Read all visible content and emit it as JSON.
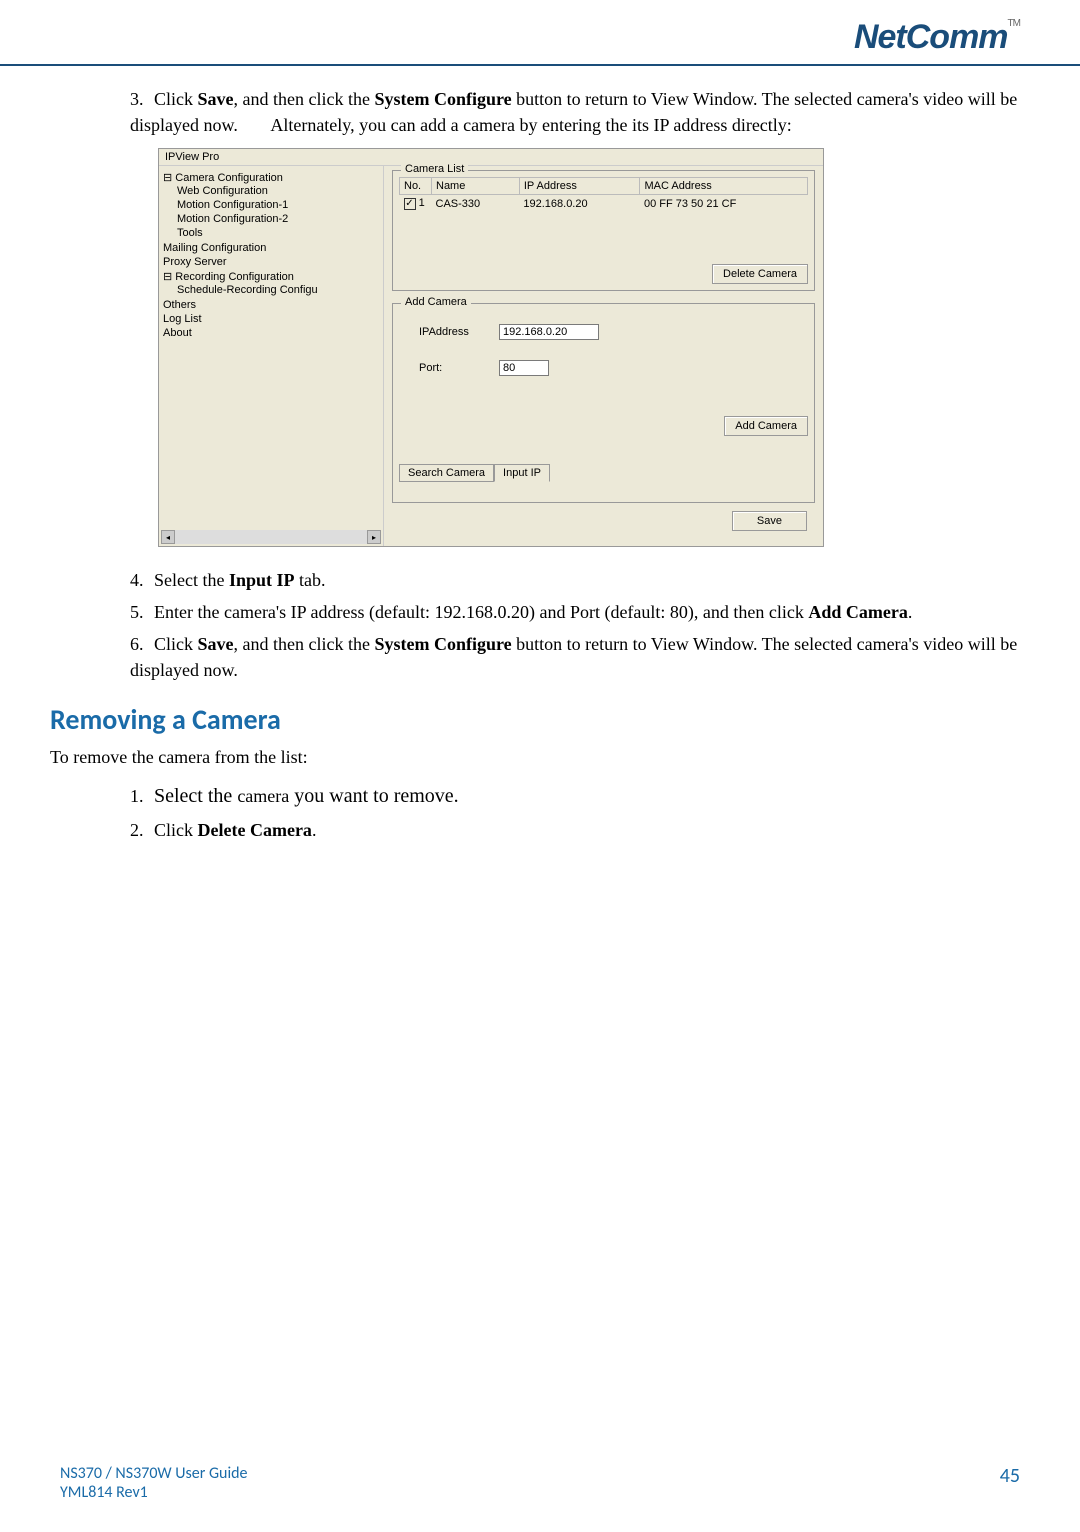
{
  "logo": "NetComm",
  "tm": "TM",
  "step3_num": "3.",
  "step3": "Click ",
  "step3_b1": "Save",
  "step3_mid": ", and then click the ",
  "step3_b2": "System Configure",
  "step3_end": " button to return to View Window. The selected camera's video will be displayed now.",
  "step3_para": "Alternately, you can add a camera by entering the its IP address directly:",
  "win": {
    "title": "IPView Pro",
    "tree": {
      "cam_cfg": "Camera Configuration",
      "web_cfg": "Web Configuration",
      "motion1": "Motion Configuration-1",
      "motion2": "Motion Configuration-2",
      "tools": "Tools",
      "mail": "Mailing Configuration",
      "proxy": "Proxy Server",
      "rec": "Recording Configuration",
      "sched": "Schedule-Recording Configu",
      "others": "Others",
      "log": "Log List",
      "about": "About"
    },
    "camlist": {
      "title": "Camera List",
      "col_no": "No.",
      "col_name": "Name",
      "col_ip": "IP Address",
      "col_mac": "MAC Address",
      "row_no": "1",
      "row_name": "CAS-330",
      "row_ip": "192.168.0.20",
      "row_mac": "00 FF 73 50 21 CF",
      "delete_btn": "Delete Camera"
    },
    "addcam": {
      "title": "Add Camera",
      "ip_label": "IPAddress",
      "ip_value": "192.168.0.20",
      "port_label": "Port:",
      "port_value": "80",
      "add_btn": "Add Camera",
      "tab1": "Search Camera",
      "tab2": "Input IP"
    },
    "save_btn": "Save"
  },
  "step4_num": "4.",
  "step4": "Select the ",
  "step4_b": "Input IP",
  "step4_end": " tab.",
  "step5_num": "5.",
  "step5": "Enter the camera's IP address (default: 192.168.0.20) and Port (default: 80), and then click ",
  "step5_b": "Add Camera",
  "step5_end": ".",
  "step6_num": "6.",
  "step6": "Click ",
  "step6_b1": "Save",
  "step6_mid": ", and then click the ",
  "step6_b2": "System Configure",
  "step6_end": " button to return to View Window. The selected camera's video will be displayed now.",
  "section": "Removing a Camera",
  "section_text": "To remove the camera from the list:",
  "r1_num": "1.",
  "r1_a": "Select the ",
  "r1_b": "camera",
  "r1_c": " you want to remove.",
  "r2_num": "2.",
  "r2": "Click ",
  "r2_b": "Delete Camera",
  "r2_end": ".",
  "footer_l1": "NS370 / NS370W User Guide",
  "footer_l2": "YML814 Rev1",
  "page_num": "45"
}
